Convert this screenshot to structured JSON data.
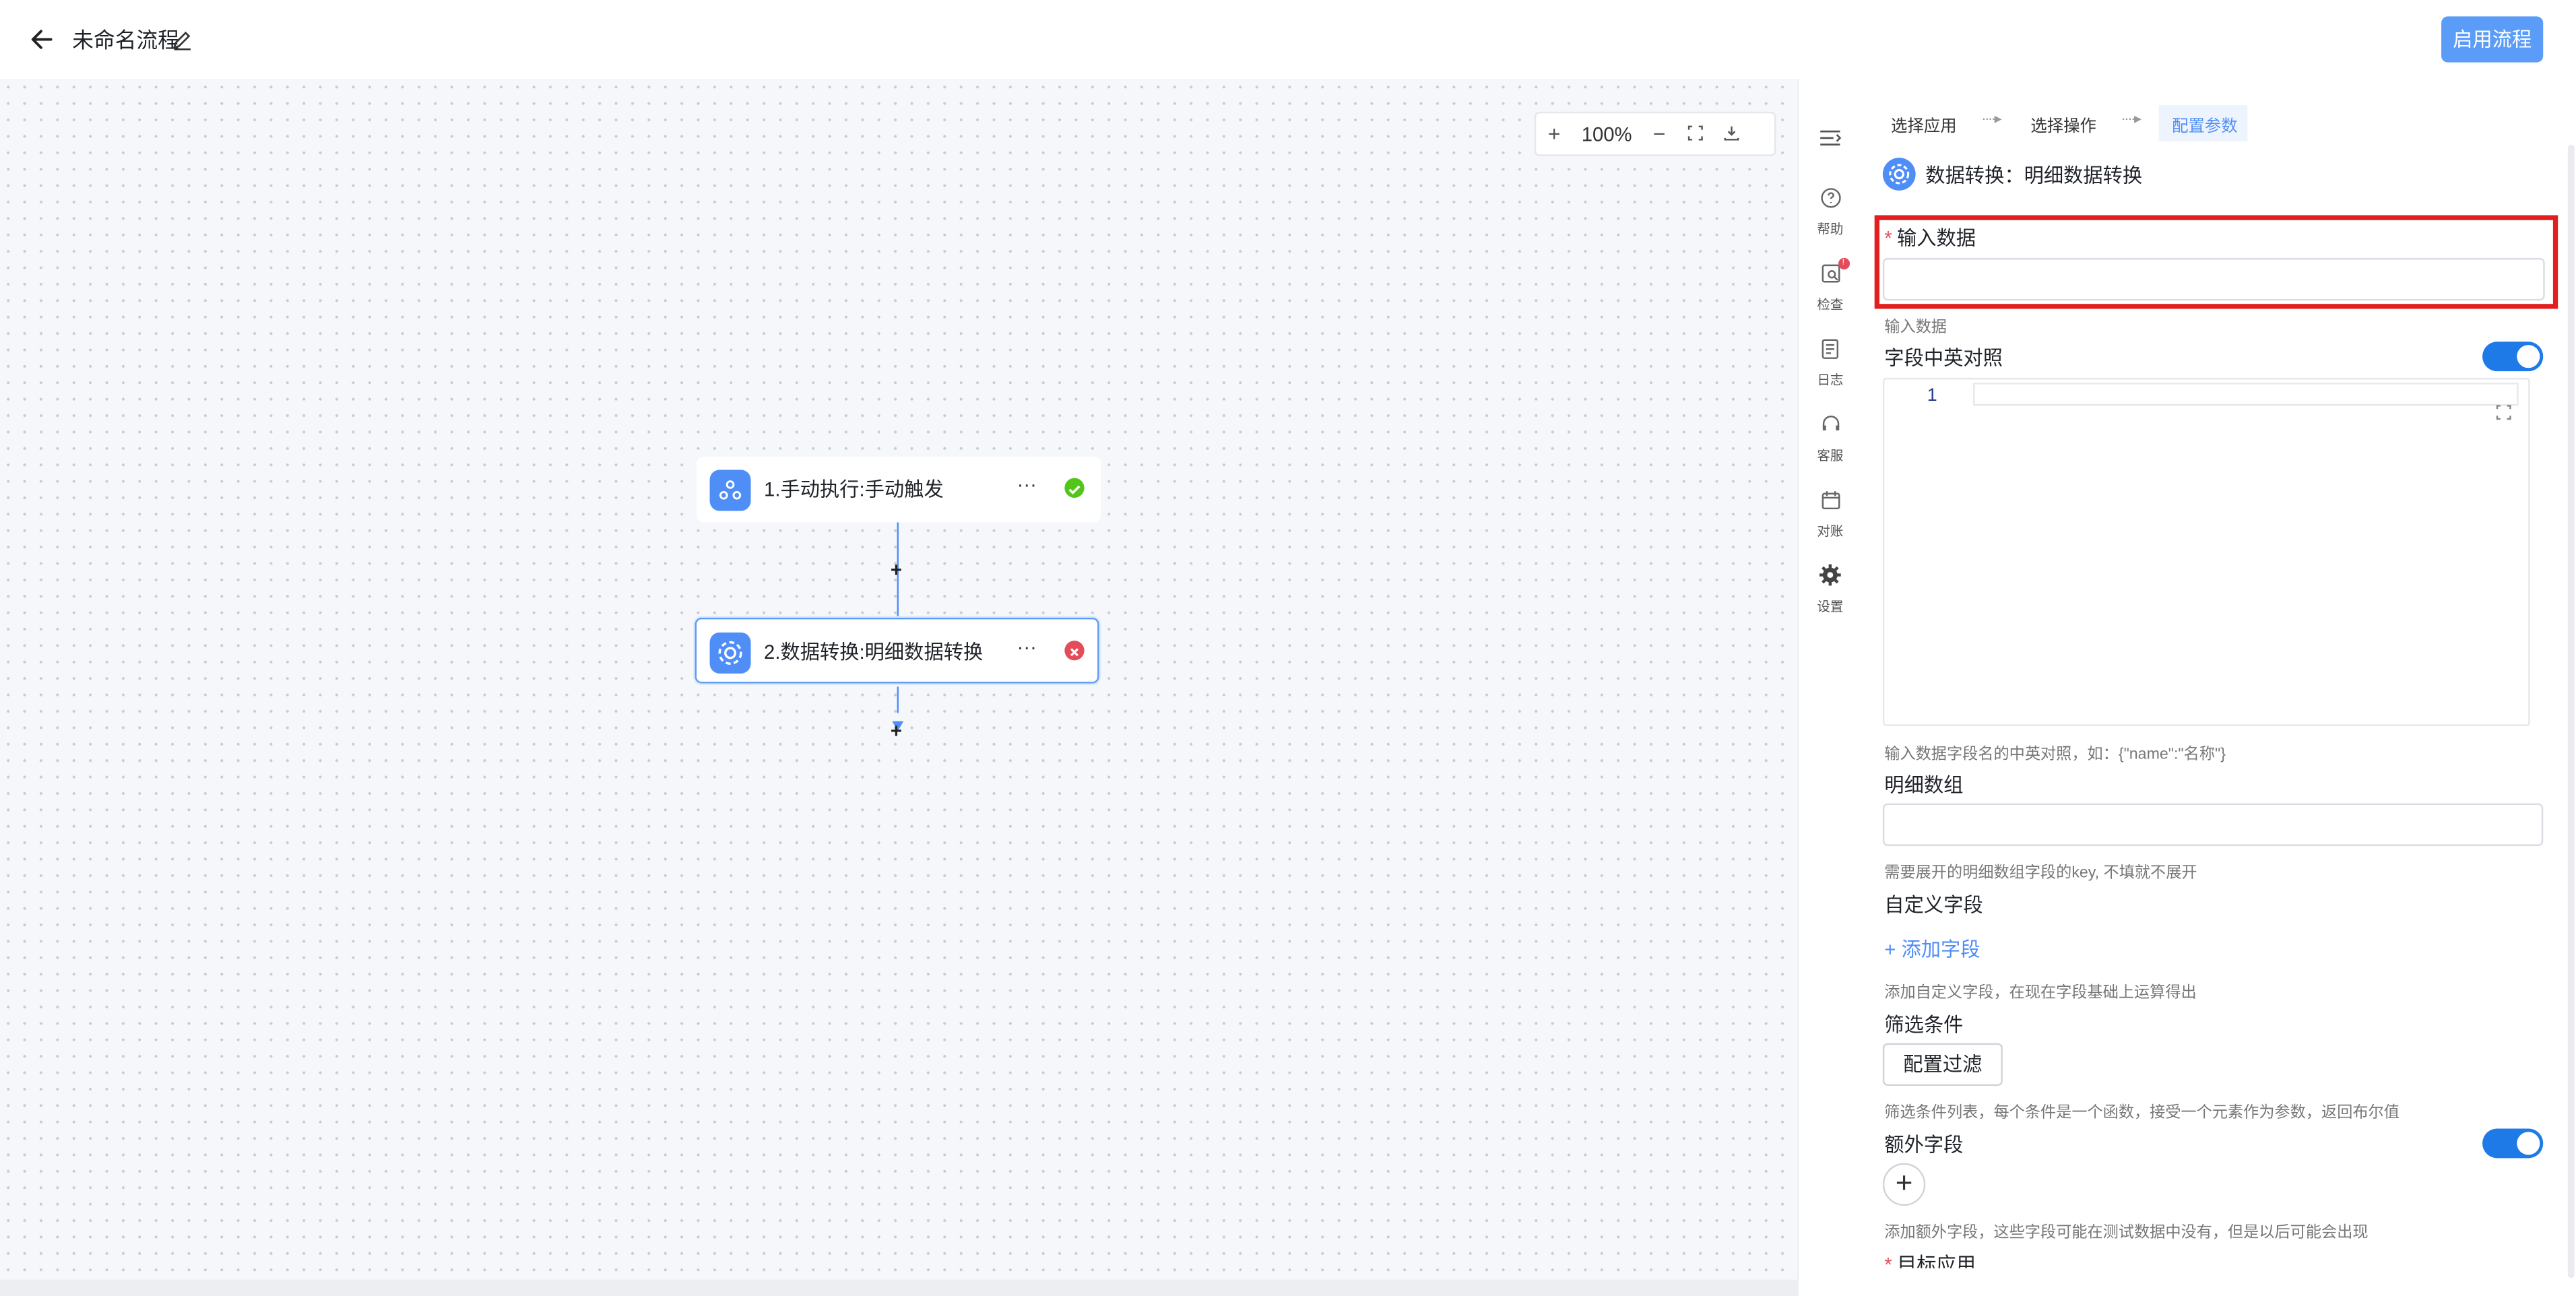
{
  "header": {
    "title": "未命名流程",
    "enable_label": "启用流程"
  },
  "canvas": {
    "zoom": {
      "plus": "+",
      "value": "100%",
      "minus": "−"
    },
    "nodes": [
      {
        "label": "1.手动执行:手动触发",
        "more": "···",
        "status": "success"
      },
      {
        "label": "2.数据转换:明细数据转换",
        "more": "···",
        "status": "error"
      }
    ],
    "plus_label": "+"
  },
  "rail": {
    "items": [
      {
        "icon": "list-icon",
        "label": ""
      },
      {
        "icon": "help-icon",
        "label": "帮助"
      },
      {
        "icon": "check-icon",
        "label": "检查",
        "badge": "!"
      },
      {
        "icon": "log-icon",
        "label": "日志"
      },
      {
        "icon": "support-icon",
        "label": "客服"
      },
      {
        "icon": "reconcile-icon",
        "label": "对账"
      },
      {
        "icon": "settings-icon",
        "label": "设置"
      }
    ]
  },
  "panel": {
    "steps": [
      {
        "label": "选择应用",
        "active": false
      },
      {
        "label": "选择操作",
        "active": false
      },
      {
        "label": "配置参数",
        "active": true
      }
    ],
    "step_sep": "····▸",
    "title": "数据转换：明细数据转换",
    "fields": {
      "input_data": {
        "required": "*",
        "label": "输入数据",
        "value": "",
        "hint": "输入数据"
      },
      "field_map": {
        "label": "字段中英对照",
        "toggle_on": true,
        "line_number": "1",
        "hint": "输入数据字段名的中英对照，如：{\"name\":\"名称\"}"
      },
      "detail_array": {
        "label": "明细数组",
        "value": "",
        "hint": "需要展开的明细数组字段的key, 不填就不展开"
      },
      "custom_fields": {
        "label": "自定义字段",
        "add_label": "+ 添加字段",
        "hint": "添加自定义字段，在现在字段基础上运算得出"
      },
      "filter": {
        "label": "筛选条件",
        "button_label": "配置过滤",
        "hint": "筛选条件列表，每个条件是一个函数，接受一个元素作为参数，返回布尔值"
      },
      "extra_fields": {
        "label": "额外字段",
        "toggle_on": true,
        "add_symbol": "+",
        "hint": "添加额外字段，这些字段可能在测试数据中没有，但是以后可能会出现"
      },
      "target_app": {
        "required": "*",
        "label": "目标应用"
      }
    }
  },
  "colors": {
    "accent": "#4f8ef7",
    "success": "#52c41a",
    "error": "#e34d59",
    "highlight": "#e21f1f"
  }
}
